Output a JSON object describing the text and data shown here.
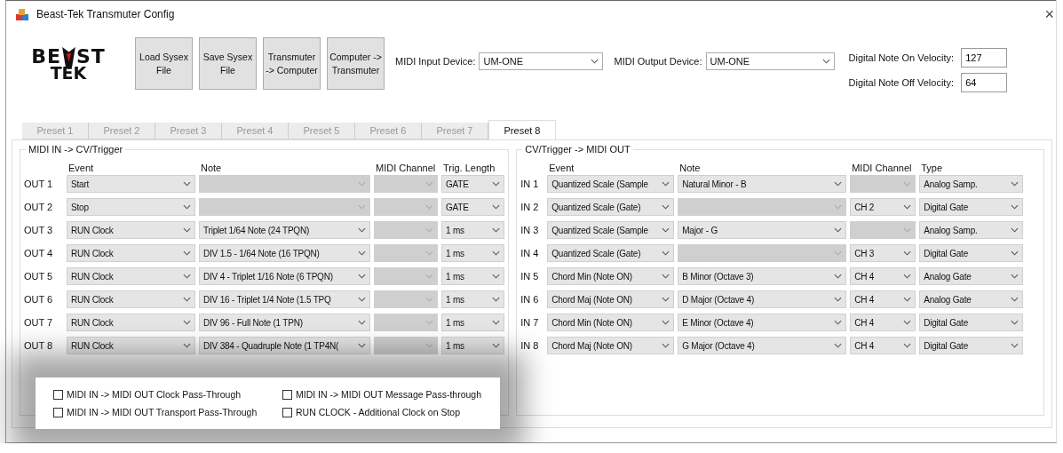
{
  "window": {
    "title": "Beast-Tek Transmuter Config",
    "close": "×"
  },
  "logo": {
    "left": "BE",
    "right": "ST",
    "bottom": "TEK"
  },
  "toolbar_buttons": [
    "Load  Sysex File",
    "Save Sysex File",
    "Transmuter -> Computer",
    "Computer -> Transmuter"
  ],
  "midi_input": {
    "label": "MIDI Input Device:",
    "value": "UM-ONE"
  },
  "midi_output": {
    "label": "MIDI Output Device:",
    "value": "UM-ONE"
  },
  "velocity_fields": [
    {
      "label": "Digital Note On Velocity:",
      "value": "127"
    },
    {
      "label": "Digital Note Off Velocity:",
      "value": "64"
    }
  ],
  "tabs": [
    {
      "label": "Preset 1",
      "selected": false
    },
    {
      "label": "Preset 2",
      "selected": false
    },
    {
      "label": "Preset 3",
      "selected": false
    },
    {
      "label": "Preset 4",
      "selected": false
    },
    {
      "label": "Preset 5",
      "selected": false
    },
    {
      "label": "Preset 6",
      "selected": false
    },
    {
      "label": "Preset 7",
      "selected": false
    },
    {
      "label": "Preset 8",
      "selected": true
    }
  ],
  "midi_in_group": {
    "title": "MIDI IN  ->  CV/Trigger",
    "columns": [
      "Event",
      "Note",
      "MIDI Channel",
      "Trig. Length"
    ],
    "rows": [
      {
        "label": "OUT 1",
        "cells": [
          {
            "value": "Start",
            "disabled": false
          },
          {
            "disabled": true
          },
          {
            "disabled": true
          },
          {
            "value": "GATE",
            "disabled": false
          }
        ]
      },
      {
        "label": "OUT 2",
        "cells": [
          {
            "value": "Stop",
            "disabled": false
          },
          {
            "disabled": true
          },
          {
            "disabled": true
          },
          {
            "value": "GATE",
            "disabled": false
          }
        ]
      },
      {
        "label": "OUT 3",
        "cells": [
          {
            "value": "RUN Clock",
            "disabled": false
          },
          {
            "value": "Triplet 1/64 Note (24 TPQN)",
            "disabled": false
          },
          {
            "disabled": true
          },
          {
            "value": "1 ms",
            "disabled": false
          }
        ]
      },
      {
        "label": "OUT 4",
        "cells": [
          {
            "value": "RUN Clock",
            "disabled": false
          },
          {
            "value": "DIV 1.5 - 1/64 Note (16 TPQN)",
            "disabled": false
          },
          {
            "disabled": true
          },
          {
            "value": "1 ms",
            "disabled": false
          }
        ]
      },
      {
        "label": "OUT 5",
        "cells": [
          {
            "value": "RUN Clock",
            "disabled": false
          },
          {
            "value": "DIV 4 - Triplet 1/16 Note (6 TPQN)",
            "disabled": false
          },
          {
            "disabled": true
          },
          {
            "value": "1 ms",
            "disabled": false
          }
        ]
      },
      {
        "label": "OUT 6",
        "cells": [
          {
            "value": "RUN Clock",
            "disabled": false
          },
          {
            "value": "DIV 16 - Triplet 1/4 Note (1.5 TPQ",
            "disabled": false
          },
          {
            "disabled": true
          },
          {
            "value": "1 ms",
            "disabled": false
          }
        ]
      },
      {
        "label": "OUT 7",
        "cells": [
          {
            "value": "RUN Clock",
            "disabled": false
          },
          {
            "value": "DIV 96 - Full Note (1 TPN)",
            "disabled": false
          },
          {
            "disabled": true
          },
          {
            "value": "1 ms",
            "disabled": false
          }
        ]
      },
      {
        "label": "OUT 8",
        "cells": [
          {
            "value": "RUN Clock",
            "disabled": false
          },
          {
            "value": "DIV 384 - Quadruple Note (1 TP4N(",
            "disabled": false
          },
          {
            "disabled": true
          },
          {
            "value": "1 ms",
            "disabled": false
          }
        ]
      }
    ]
  },
  "cv_group": {
    "title": "CV/Trigger  ->  MIDI OUT",
    "columns": [
      "Event",
      "Note",
      "MIDI Channel",
      "Type"
    ],
    "rows": [
      {
        "label": "IN 1",
        "cells": [
          {
            "value": "Quantized Scale (Sample",
            "disabled": false
          },
          {
            "value": "Natural Minor - B",
            "disabled": false
          },
          {
            "disabled": true
          },
          {
            "value": "Analog Samp.",
            "disabled": false
          }
        ]
      },
      {
        "label": "IN 2",
        "cells": [
          {
            "value": "Quantized Scale (Gate)",
            "disabled": false
          },
          {
            "disabled": true
          },
          {
            "value": "CH 2",
            "disabled": false
          },
          {
            "value": "Digital Gate",
            "disabled": false
          }
        ]
      },
      {
        "label": "IN 3",
        "cells": [
          {
            "value": "Quantized Scale (Sample",
            "disabled": false
          },
          {
            "value": "Major - G",
            "disabled": false
          },
          {
            "disabled": true
          },
          {
            "value": "Analog Samp.",
            "disabled": false
          }
        ]
      },
      {
        "label": "IN 4",
        "cells": [
          {
            "value": "Quantized Scale (Gate)",
            "disabled": false
          },
          {
            "disabled": true
          },
          {
            "value": "CH 3",
            "disabled": false
          },
          {
            "value": "Digital Gate",
            "disabled": false
          }
        ]
      },
      {
        "label": "IN 5",
        "cells": [
          {
            "value": "Chord Min (Note ON)",
            "disabled": false
          },
          {
            "value": "B Minor (Octave 3)",
            "disabled": false
          },
          {
            "value": "CH 4",
            "disabled": false
          },
          {
            "value": "Analog Gate",
            "disabled": false
          }
        ]
      },
      {
        "label": "IN 6",
        "cells": [
          {
            "value": "Chord Maj (Note ON)",
            "disabled": false
          },
          {
            "value": "D Major (Octave 4)",
            "disabled": false
          },
          {
            "value": "CH 4",
            "disabled": false
          },
          {
            "value": "Analog Gate",
            "disabled": false
          }
        ]
      },
      {
        "label": "IN 7",
        "cells": [
          {
            "value": "Chord Min (Note ON)",
            "disabled": false
          },
          {
            "value": "E Minor (Octave 4)",
            "disabled": false
          },
          {
            "value": "CH 4",
            "disabled": false
          },
          {
            "value": "Digital Gate",
            "disabled": false
          }
        ]
      },
      {
        "label": "IN 8",
        "cells": [
          {
            "value": "Chord Maj (Note ON)",
            "disabled": false
          },
          {
            "value": "G Major (Octave 4)",
            "disabled": false
          },
          {
            "value": "CH 4",
            "disabled": false
          },
          {
            "value": "Digital Gate",
            "disabled": false
          }
        ]
      }
    ]
  },
  "options": [
    {
      "label": "MIDI IN -> MIDI OUT Clock Pass-Through",
      "checked": false
    },
    {
      "label": "MIDI IN -> MIDI OUT Message Pass-through",
      "checked": false
    },
    {
      "label": "MIDI IN -> MIDI OUT Transport Pass-Through",
      "checked": false
    },
    {
      "label": "RUN CLOCK - Additional Clock on Stop",
      "checked": false
    }
  ]
}
